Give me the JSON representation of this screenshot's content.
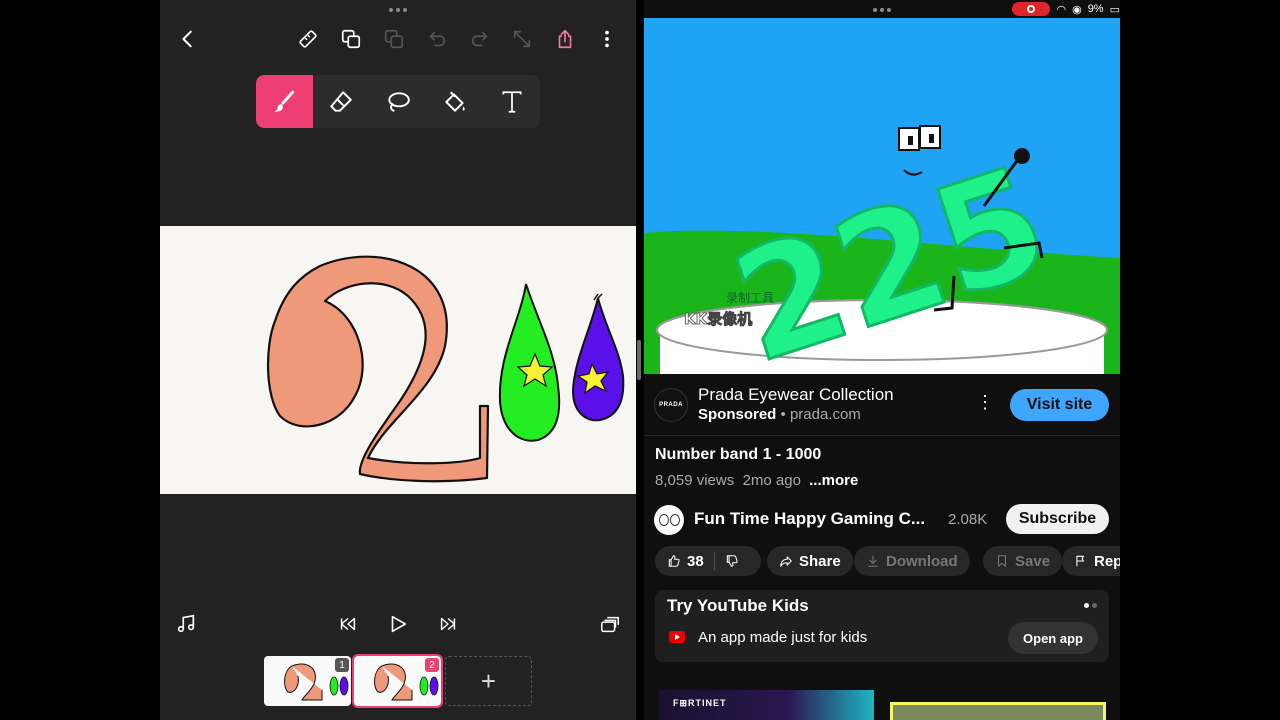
{
  "drawing_app": {
    "toolbar_icons": [
      "back-chevron-icon",
      "ruler-icon",
      "duplicate-icon",
      "layers-copy-icon",
      "undo-icon",
      "redo-icon",
      "resize-icon",
      "share-icon",
      "more-vertical-icon"
    ],
    "tools": [
      {
        "name": "brush",
        "active": true
      },
      {
        "name": "eraser",
        "active": false
      },
      {
        "name": "lasso",
        "active": false
      },
      {
        "name": "fill-bucket",
        "active": false
      },
      {
        "name": "text",
        "label": "T",
        "active": false
      }
    ],
    "frames": [
      {
        "number": "1",
        "badge_color": "#555555"
      },
      {
        "number": "2",
        "badge_color": "#ee3f73"
      }
    ],
    "add_frame_label": "+",
    "colors": {
      "accent": "#ee3f73",
      "canvas": "#f7f6f2",
      "digit_fill": "#f0987a",
      "green_drop": "#22ee22",
      "purple_drop": "#5a10e8",
      "star": "#f7f132"
    }
  },
  "status_bar": {
    "battery": "9%"
  },
  "youtube": {
    "video_overlay": {
      "line1": "录制工具",
      "line2": "KK录像机",
      "number": "225"
    },
    "ad": {
      "logo_text": "PRADA",
      "title": "Prada Eyewear Collection",
      "sponsored_label": "Sponsored",
      "separator": " • ",
      "domain": "prada.com",
      "menu_icon": "⋮",
      "cta_label": "Visit site"
    },
    "video": {
      "title": "Number band 1 - 1000",
      "views": "8,059 views",
      "age": "2mo ago",
      "more_label": "...more"
    },
    "channel": {
      "name": "Fun Time Happy Gaming C...",
      "subscribers": "2.08K",
      "subscribe_label": "Subscribe"
    },
    "actions": {
      "likes": "38",
      "share": "Share",
      "download": "Download",
      "save": "Save",
      "report": "Repo"
    },
    "kids_card": {
      "title": "Try YouTube Kids",
      "subtitle": "An app made just for kids",
      "button": "Open app"
    },
    "next_thumb": {
      "brand": "F⊞RTINET"
    },
    "colors": {
      "cta": "#3ea6ff",
      "sky": "#1fa3f5",
      "grass": "#1ab51a",
      "character": "#1ef08a"
    }
  }
}
